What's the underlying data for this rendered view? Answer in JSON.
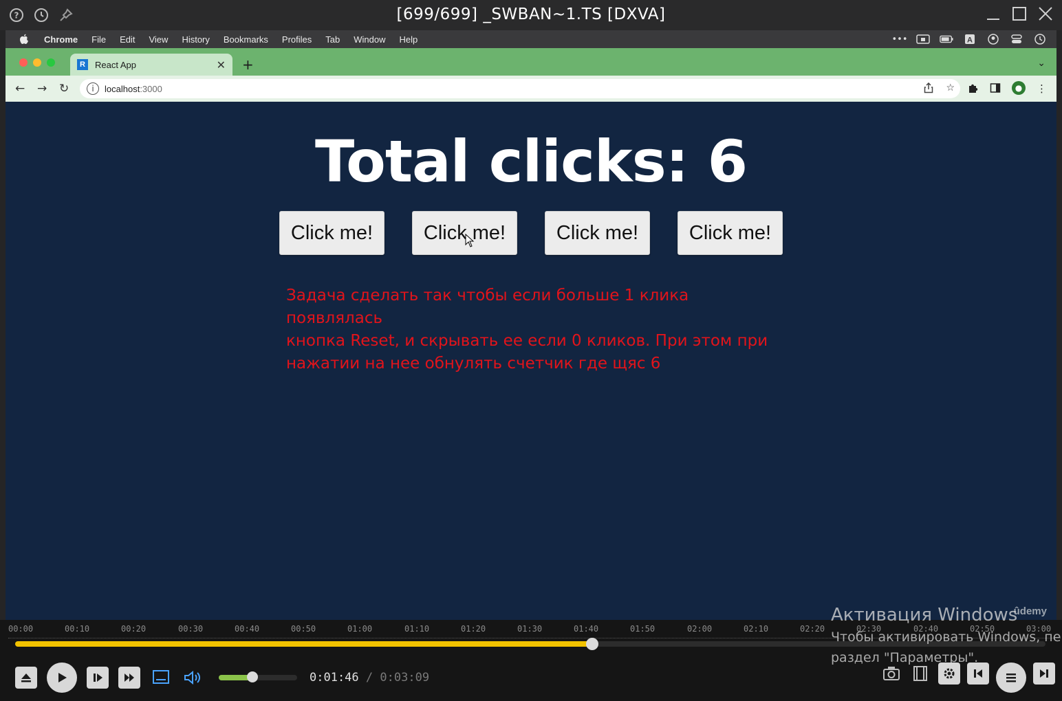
{
  "player": {
    "title": "[699/699] _SWBAN~1.TS [DXVA]",
    "help_icon": "question-circle-icon",
    "history_icon": "clock-icon",
    "pin_icon": "pin-icon",
    "time_current": "0:01:46",
    "time_separator": "/",
    "time_total": "0:03:09",
    "progress_fraction": 0.56,
    "volume_fraction": 0.43,
    "timeline_ticks": [
      "00:00",
      "00:10",
      "00:20",
      "00:30",
      "00:40",
      "00:50",
      "01:00",
      "01:10",
      "01:20",
      "01:30",
      "01:40",
      "01:50",
      "02:00",
      "02:10",
      "02:20",
      "02:30",
      "02:40",
      "02:50",
      "03:00"
    ]
  },
  "mac_menu": {
    "items": [
      "Chrome",
      "File",
      "Edit",
      "View",
      "History",
      "Bookmarks",
      "Profiles",
      "Tab",
      "Window",
      "Help"
    ]
  },
  "browser": {
    "tab_title": "React App",
    "tab_favicon": "R",
    "url_host": "localhost",
    "url_port": ":3000"
  },
  "page": {
    "heading": "Total clicks: 6",
    "buttons": [
      "Click me!",
      "Click me!",
      "Click me!",
      "Click me!"
    ],
    "task_line1": "Задача сделать так чтобы если больше 1 клика появлялась",
    "task_line2": "кнопка Reset, и скрывать ее если 0 кликов. При этом при",
    "task_line3": "нажатии на нее обнулять счетчик где щяс 6",
    "udemy": "ûdemy"
  },
  "watermark": {
    "line1": "Активация Windows",
    "line2": "Чтобы активировать Windows, пе",
    "line3": "раздел \"Параметры\"."
  },
  "colors": {
    "page_bg": "#122541",
    "task_text": "#e1141b",
    "chrome_frame": "#6cb36e",
    "seek_fill": "#f2c200",
    "volume_fill": "#8bc34a"
  }
}
